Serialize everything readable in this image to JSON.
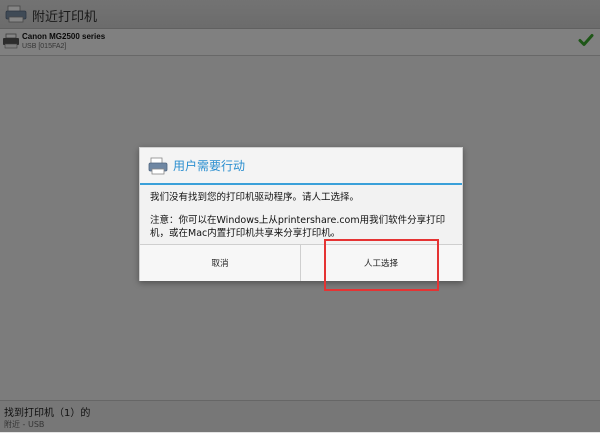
{
  "action_bar": {
    "title": "附近打印机",
    "icon": "printer-share-icon"
  },
  "printers": [
    {
      "name": "Canon MG2500 series",
      "connection": "USB [015FA2]",
      "icon": "printer-icon",
      "status_icon": "check-icon"
    }
  ],
  "footer": {
    "title": "找到打印机（1）的",
    "subtitle": "附近 - USB"
  },
  "dialog": {
    "icon": "printer-share-icon",
    "title": "用户需要行动",
    "message_1": "我们没有找到您的打印机驱动程序。请人工选择。",
    "message_2": "注意：你可以在Windows上从printershare.com用我们软件分享打印机，或在Mac内置打印机共享来分享打印机。",
    "buttons": {
      "cancel": "取消",
      "manual_select": "人工选择"
    }
  },
  "colors": {
    "accent": "#3aa0d9",
    "highlight": "#e53333",
    "check": "#3aa52c"
  }
}
